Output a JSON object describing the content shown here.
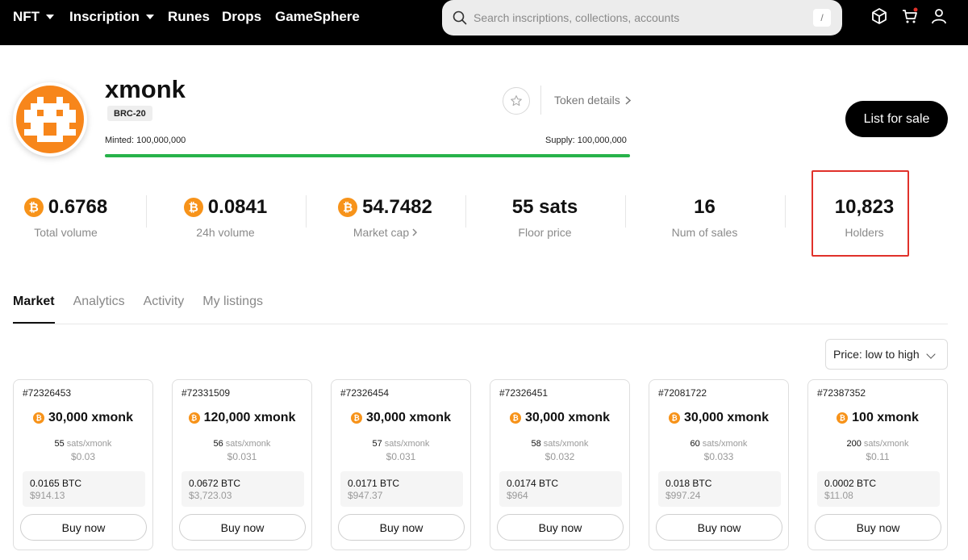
{
  "nav": {
    "items": [
      {
        "label": "NFT",
        "has_caret": true
      },
      {
        "label": "Inscription",
        "has_caret": true
      },
      {
        "label": "Runes",
        "has_caret": false
      },
      {
        "label": "Drops",
        "has_caret": false
      },
      {
        "label": "GameSphere",
        "has_caret": false
      }
    ],
    "search_placeholder": "Search inscriptions, collections, accounts",
    "search_shortcut": "/",
    "icons": [
      "box-icon",
      "cart-icon",
      "user-icon"
    ]
  },
  "token": {
    "name": "xmonk",
    "standard": "BRC-20",
    "minted": "Minted: 100,000,000",
    "supply": "Supply: 100,000,000",
    "minted_fraction": 1.0,
    "token_details_label": "Token details",
    "list_for_sale_label": "List for sale",
    "avatar_color": "#f7861b"
  },
  "stats": [
    {
      "value": "0.6768",
      "label": "Total volume",
      "btc_icon": true
    },
    {
      "value": "0.0841",
      "label": "24h volume",
      "btc_icon": true
    },
    {
      "value": "54.7482",
      "label": "Market cap",
      "btc_icon": true
    },
    {
      "value": "55 sats",
      "label": "Floor price",
      "btc_icon": false
    },
    {
      "value": "16",
      "label": "Num of sales",
      "btc_icon": false
    },
    {
      "value": "10,823",
      "label": "Holders",
      "btc_icon": false
    }
  ],
  "tabs": [
    {
      "label": "Market",
      "active": true
    },
    {
      "label": "Analytics",
      "active": false
    },
    {
      "label": "Activity",
      "active": false
    },
    {
      "label": "My listings",
      "active": false
    }
  ],
  "sort": {
    "selected": "Price: low to high"
  },
  "listings": [
    {
      "id": "#72326453",
      "amount": "30,000 xmonk",
      "sats": "55",
      "unit": "sats/xmonk",
      "usd_unit": "$0.03",
      "btc": "0.0165 BTC",
      "usd": "$914.13",
      "buy_label": "Buy now"
    },
    {
      "id": "#72331509",
      "amount": "120,000 xmonk",
      "sats": "56",
      "unit": "sats/xmonk",
      "usd_unit": "$0.031",
      "btc": "0.0672 BTC",
      "usd": "$3,723.03",
      "buy_label": "Buy now"
    },
    {
      "id": "#72326454",
      "amount": "30,000 xmonk",
      "sats": "57",
      "unit": "sats/xmonk",
      "usd_unit": "$0.031",
      "btc": "0.0171 BTC",
      "usd": "$947.37",
      "buy_label": "Buy now"
    },
    {
      "id": "#72326451",
      "amount": "30,000 xmonk",
      "sats": "58",
      "unit": "sats/xmonk",
      "usd_unit": "$0.032",
      "btc": "0.0174 BTC",
      "usd": "$964",
      "buy_label": "Buy now"
    },
    {
      "id": "#72081722",
      "amount": "30,000 xmonk",
      "sats": "60",
      "unit": "sats/xmonk",
      "usd_unit": "$0.033",
      "btc": "0.018 BTC",
      "usd": "$997.24",
      "buy_label": "Buy now"
    },
    {
      "id": "#72387352",
      "amount": "100 xmonk",
      "sats": "200",
      "unit": "sats/xmonk",
      "usd_unit": "$0.11",
      "btc": "0.0002 BTC",
      "usd": "$11.08",
      "buy_label": "Buy now"
    }
  ],
  "colors": {
    "accent_green": "#27b24a",
    "btc_orange": "#f7931a",
    "highlight_red": "#e0312a"
  }
}
